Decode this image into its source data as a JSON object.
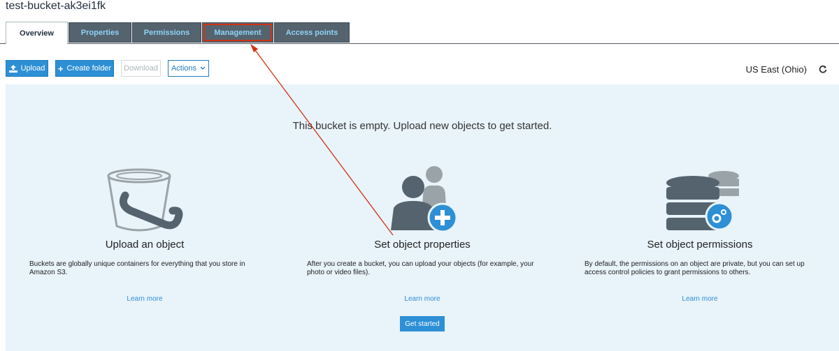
{
  "bucket": {
    "title": "test-bucket-ak3ei1fk"
  },
  "tabs": [
    {
      "label": "Overview"
    },
    {
      "label": "Properties"
    },
    {
      "label": "Permissions"
    },
    {
      "label": "Management"
    },
    {
      "label": "Access points"
    }
  ],
  "toolbar": {
    "upload_label": "Upload",
    "create_folder_label": "Create folder",
    "download_label": "Download",
    "actions_label": "Actions"
  },
  "region": {
    "label": "US East (Ohio)"
  },
  "panel": {
    "empty_message": "This bucket is empty. Upload new objects to get started.",
    "columns": [
      {
        "title": "Upload an object",
        "description": "Buckets are globally unique containers for everything that you store in Amazon S3.",
        "link": "Learn more"
      },
      {
        "title": "Set object properties",
        "description": "After you create a bucket, you can upload your objects (for example, your photo or video files).",
        "link": "Learn more"
      },
      {
        "title": "Set object permissions",
        "description": "By default, the permissions on an object are private, but you can set up access control policies to grant permissions to others.",
        "link": "Learn more"
      }
    ],
    "get_started_label": "Get started"
  },
  "colors": {
    "accent": "#2d8fd5",
    "tab_bg": "#55636f",
    "annotation": "#d13212",
    "panel_bg": "#e8f3fa"
  }
}
